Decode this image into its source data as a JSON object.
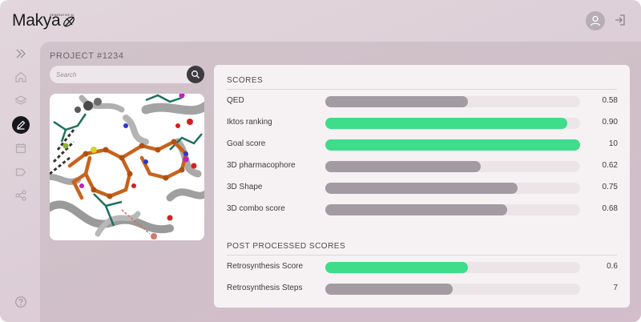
{
  "brand": {
    "name": "Makya",
    "tagline": "GENERATIVE AI"
  },
  "header": {
    "avatar_icon": "user-icon",
    "logout_icon": "logout-icon"
  },
  "sidebar": {
    "items": [
      {
        "name": "expand",
        "icon": "chevrons-right-icon",
        "active": false
      },
      {
        "name": "home",
        "icon": "home-icon",
        "active": false
      },
      {
        "name": "layers",
        "icon": "layers-icon",
        "active": false
      },
      {
        "name": "edit",
        "icon": "pen-icon",
        "active": true
      },
      {
        "name": "calendar",
        "icon": "calendar-icon",
        "active": false
      },
      {
        "name": "tag",
        "icon": "tag-icon",
        "active": false
      },
      {
        "name": "share",
        "icon": "share-icon",
        "active": false
      }
    ],
    "help_icon": "help-icon"
  },
  "project": {
    "title": "PROJECT #1234"
  },
  "search": {
    "placeholder": "Search",
    "value": ""
  },
  "molecule": {
    "icon": "molecule-3d-view"
  },
  "scores": {
    "title": "SCORES",
    "rows": [
      {
        "label": "QED",
        "value": "0.58",
        "fraction": 0.56,
        "color": "#a39ba2"
      },
      {
        "label": "Iktos ranking",
        "value": "0.90",
        "fraction": 0.95,
        "color": "#3fdc8c"
      },
      {
        "label": "Goal score",
        "value": "10",
        "fraction": 1.0,
        "color": "#3fdc8c"
      },
      {
        "label": "3D pharmacophore",
        "value": "0.62",
        "fraction": 0.61,
        "color": "#a39ba2"
      },
      {
        "label": "3D Shape",
        "value": "0.75",
        "fraction": 0.755,
        "color": "#a39ba2"
      },
      {
        "label": "3D combo score",
        "value": "0.68",
        "fraction": 0.715,
        "color": "#a39ba2"
      }
    ]
  },
  "post_scores": {
    "title": "POST PROCESSED SCORES",
    "rows": [
      {
        "label": "Retrosynthesis Score",
        "value": "0.6",
        "fraction": 0.56,
        "color": "#3fdc8c"
      },
      {
        "label": "Retrosynthesis Steps",
        "value": "7",
        "fraction": 0.5,
        "color": "#a39ba2"
      }
    ]
  }
}
